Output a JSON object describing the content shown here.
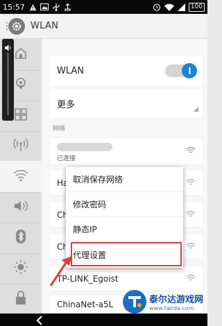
{
  "status_bar": {
    "time": "15:57",
    "battery": "100",
    "left_icons": [
      "warning-icon",
      "image-icon",
      "usb-icon",
      "usb-debug-icon"
    ],
    "right_icons": [
      "alarm-icon",
      "wifi-icon",
      "signal-icon"
    ]
  },
  "header": {
    "title": "WLAN"
  },
  "sidebar": {
    "items": [
      "home-icon",
      "location-icon",
      "apps-icon",
      "hotspot-icon",
      "wifi-icon",
      "volume-icon",
      "bluetooth-icon",
      "brightness-icon",
      "lock-icon"
    ],
    "active": "wifi-icon"
  },
  "main": {
    "wlan_label": "WLAN",
    "wlan_enabled": true,
    "more_label": "更多",
    "section_label": "网络",
    "connected_status": "已连接",
    "networks": [
      {
        "ssid": "Ha"
      },
      {
        "ssid": "Ch"
      },
      {
        "ssid": "Ch"
      },
      {
        "ssid": "TP-LINK_Egoist"
      },
      {
        "ssid": "ChinaNet-a5L"
      }
    ]
  },
  "context_menu": {
    "items": [
      "取消保存网络",
      "修改密码",
      "静态IP",
      "代理设置"
    ],
    "highlighted": "代理设置"
  },
  "watermark": {
    "name": "泰尔达游戏网",
    "url": "www.tairda.com"
  },
  "colors": {
    "accent": "#1a86d6",
    "highlight": "#e23a3a"
  }
}
